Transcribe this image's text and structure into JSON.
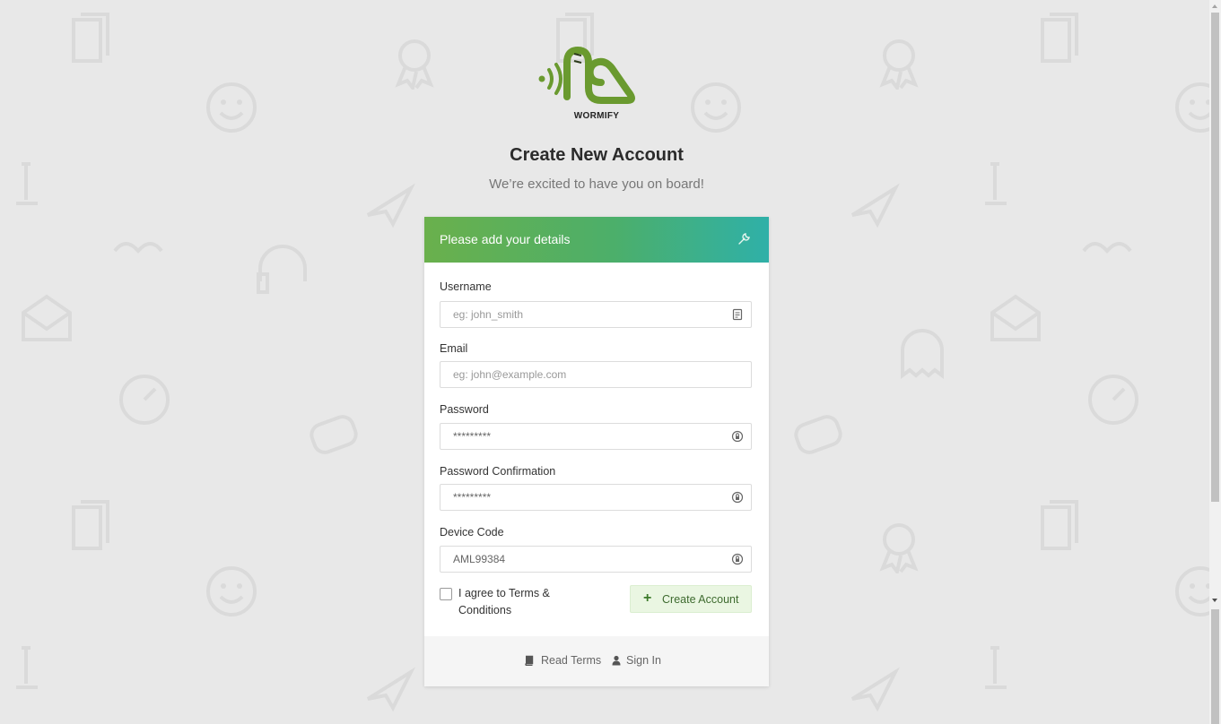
{
  "brand": {
    "logo_icon": "wormify-logo",
    "name": "WORMIFY",
    "color": "#6a9a2f"
  },
  "heading": {
    "title": "Create New Account",
    "subtitle": "We’re excited to have you on board!"
  },
  "card": {
    "header": {
      "text": "Please add your details",
      "icon": "wrench-icon",
      "gradient": [
        "#6ab04c",
        "#2fb0a8"
      ]
    },
    "fields": [
      {
        "label": "Username",
        "placeholder": "eg: john_smith",
        "value": "",
        "icon": "id-card-icon"
      },
      {
        "label": "Email",
        "placeholder": "eg: john@example.com",
        "value": "",
        "icon": ""
      },
      {
        "label": "Password",
        "placeholder": "",
        "value": "*********",
        "icon": "lock-icon"
      },
      {
        "label": "Password Confirmation",
        "placeholder": "",
        "value": "*********",
        "icon": "lock-icon"
      },
      {
        "label": "Device Code",
        "placeholder": "",
        "value": "AML99384",
        "icon": "lock-icon"
      }
    ],
    "terms": {
      "checked": false,
      "label": "I agree to Terms & Conditions"
    },
    "submit": {
      "label": "Create Account",
      "icon": "plus-icon",
      "background": "#eaf6e2"
    },
    "footer": {
      "links": [
        {
          "label": "Read Terms",
          "icon": "book-icon"
        },
        {
          "label": "Sign In",
          "icon": "user-icon"
        }
      ]
    }
  }
}
